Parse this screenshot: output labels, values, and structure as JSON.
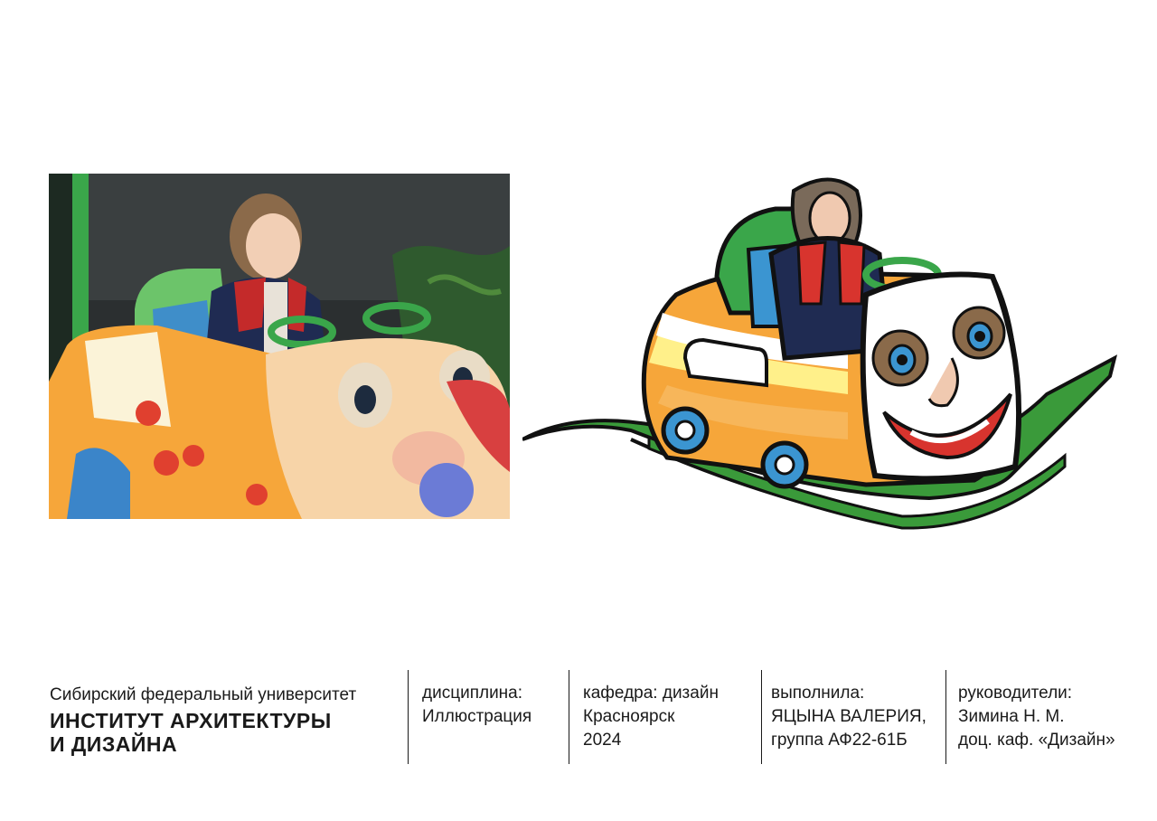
{
  "images": {
    "photo": {
      "description_icon": "photo-child-in-ride-car"
    },
    "illustration": {
      "description_icon": "illustration-ride-car-with-face"
    }
  },
  "colors": {
    "car_orange": "#f6a63a",
    "car_yellow": "#fff08a",
    "seat_green": "#3aa64a",
    "track_green": "#3a9a3a",
    "jacket_navy": "#1f2b52",
    "vest_red": "#d8342e",
    "wheel_blue": "#3b95d1"
  },
  "footer": {
    "university": "Сибирский федеральный университет",
    "institute_line1": "ИНСТИТУТ АРХИТЕКТУРЫ",
    "institute_line2": "И ДИЗАЙНА",
    "discipline_label": "дисциплина:",
    "discipline_value": "Иллюстрация",
    "department": "кафедра: дизайн",
    "city": "Красноярск",
    "year": "2024",
    "author_label": "выполнила:",
    "author_name": "ЯЦЫНА ВАЛЕРИЯ,",
    "author_group": "группа АФ22-61Б",
    "supervisors_label": "руководители:",
    "supervisor_1": "Зимина Н. М.",
    "supervisor_2": "доц. каф. «Дизайн»"
  }
}
